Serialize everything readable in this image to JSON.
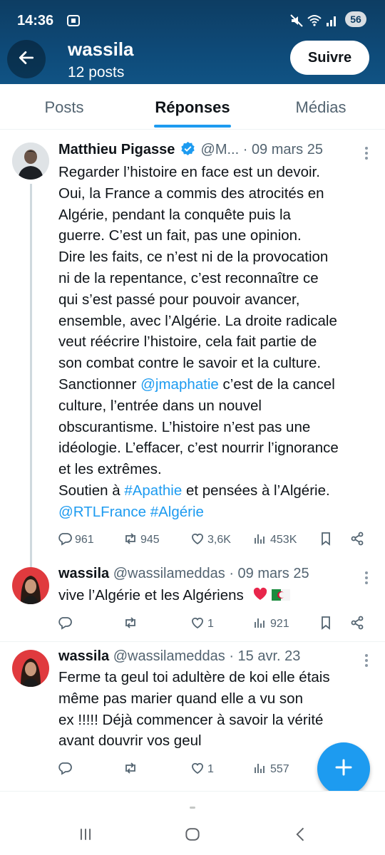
{
  "status_bar": {
    "time": "14:36",
    "battery": "56",
    "icons": [
      "screenshot-icon",
      "mute-icon",
      "wifi-icon",
      "signal-icon"
    ]
  },
  "header": {
    "name": "wassila",
    "posts_count": "12 posts",
    "follow_label": "Suivre"
  },
  "tabs": [
    {
      "label": "Posts",
      "active": false
    },
    {
      "label": "Réponses",
      "active": true
    },
    {
      "label": "Médias",
      "active": false
    }
  ],
  "tweets": [
    {
      "author": "Matthieu Pigasse",
      "verified": true,
      "handle": "@M...",
      "date": "09 mars 25",
      "body_lines": [
        "Regarder l’histoire en face est un devoir.",
        "Oui, la France a commis des atrocités en",
        "Algérie, pendant la conquête puis la",
        "guerre. C’est un fait, pas une opinion.",
        "Dire les faits, ce n’est ni de la provocation",
        "ni de la repentance, c’est reconnaître ce",
        "qui s’est passé pour pouvoir avancer,",
        "ensemble, avec l’Algérie.  La droite radicale",
        "veut réécrire l’histoire, cela fait partie de",
        "son combat contre le savoir et la culture."
      ],
      "line11_pre": "Sanctionner ",
      "line11_link": "@jmaphatie",
      "line11_post": " c’est de la cancel",
      "lines_after": [
        "culture, l’entrée dans un nouvel",
        "obscurantisme. L’histoire n’est pas une",
        "idéologie. L’effacer, c’est nourrir l’ignorance",
        "et les extrêmes."
      ],
      "line16_pre": "Soutien à ",
      "line16_link": "#Apathie",
      "line16_post": " et pensées à l’Algérie.",
      "line17_link1": "@RTLFrance",
      "line17_link2": "#Algérie",
      "replies": "961",
      "retweets": "945",
      "likes": "3,6K",
      "views": "453K"
    },
    {
      "author": "wassila",
      "handle": "@wassilameddas",
      "date": "09 mars 25",
      "body": "vive l’Algérie et les Algériens",
      "emoji": [
        "red-heart-emoji",
        "algeria-flag-emoji"
      ],
      "replies": "",
      "retweets": "",
      "likes": "1",
      "views": "921"
    },
    {
      "author": "wassila",
      "handle": "@wassilameddas",
      "date": "15 avr. 23",
      "body_lines": [
        "Ferme ta geul toi adultère de koi elle étais",
        "même pas marier quand elle a vu son",
        "ex !!!!! Déjà commencer à savoir la vérité",
        "avant douvrir vos geul"
      ],
      "replies": "",
      "retweets": "",
      "likes": "1",
      "views": "557"
    }
  ],
  "colors": {
    "header_bg": "#0e4a78",
    "accent": "#1d9bf0",
    "text": "#0f1419",
    "muted": "#536471"
  },
  "fab": {
    "icon": "plus-icon"
  },
  "nav": {
    "icons": [
      "recent-apps-icon",
      "home-icon",
      "back-icon"
    ]
  }
}
